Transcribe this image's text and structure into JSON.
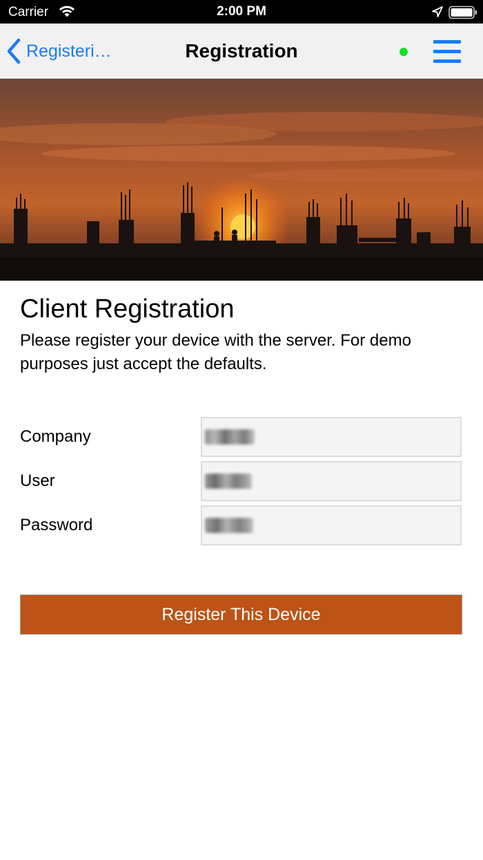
{
  "status_bar": {
    "carrier": "Carrier",
    "time": "2:00 PM",
    "wifi_icon": "wifi-icon",
    "location_icon": "location-arrow-icon",
    "battery_icon": "battery-full-icon"
  },
  "nav": {
    "back_label": "Registeri…",
    "back_icon": "chevron-left-icon",
    "title": "Registration",
    "status_dot_color": "#14e020",
    "menu_icon": "hamburger-menu-icon",
    "accent_color": "#1a7cf5"
  },
  "hero": {
    "description_icon": "construction-sunset-image"
  },
  "content": {
    "heading": "Client Registration",
    "intro": "Please register your device with the server. For demo purposes just accept the defaults."
  },
  "form": {
    "company_label": "Company",
    "user_label": "User",
    "password_label": "Password"
  },
  "register_button": {
    "label": "Register This Device",
    "color": "#bd5316"
  }
}
